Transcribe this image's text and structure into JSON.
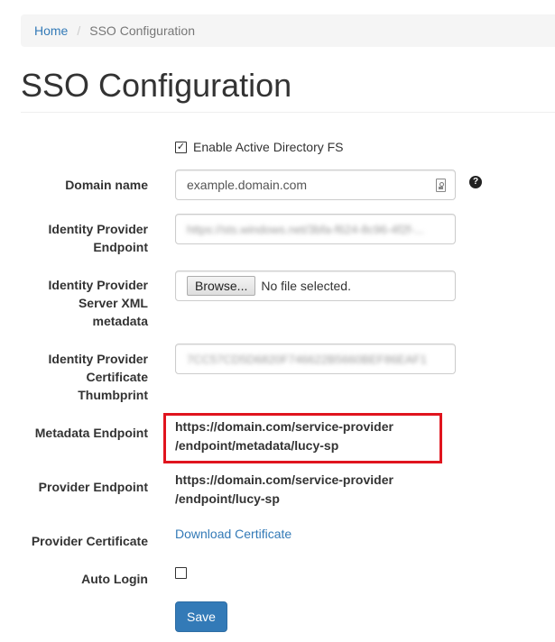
{
  "breadcrumb": {
    "home": "Home",
    "separator": "/",
    "current": "SSO Configuration"
  },
  "page": {
    "title": "SSO Configuration"
  },
  "form": {
    "enable_adfs": {
      "label": "Enable Active Directory FS",
      "checked": true
    },
    "domain_name": {
      "label": "Domain name",
      "value": "example.domain.com",
      "help_icon": "question-circle-icon"
    },
    "idp_endpoint": {
      "label_line1": "Identity Provider",
      "label_line2": "Endpoint",
      "value": "https://sts.windows.net/3bfa-f624-8c96-4f2f-..."
    },
    "idp_metadata": {
      "label_line1": "Identity Provider",
      "label_line2": "Server XML",
      "label_line3": "metadata",
      "browse_label": "Browse...",
      "file_status": "No file selected."
    },
    "idp_thumbprint": {
      "label_line1": "Identity Provider",
      "label_line2": "Certificate",
      "label_line3": "Thumbprint",
      "value": "7CC57CD5D6820F746622B5660BEF86EAF1"
    },
    "metadata_endpoint": {
      "label": "Metadata Endpoint",
      "value_line1": "https://domain.com/service-provider",
      "value_line2": "/endpoint/metadata/lucy-sp"
    },
    "provider_endpoint": {
      "label": "Provider Endpoint",
      "value_line1": "https://domain.com/service-provider",
      "value_line2": "/endpoint/lucy-sp"
    },
    "provider_certificate": {
      "label": "Provider Certificate",
      "link": "Download Certificate"
    },
    "auto_login": {
      "label": "Auto Login",
      "checked": false
    },
    "save_label": "Save"
  },
  "colors": {
    "link": "#337ab7",
    "primary_button": "#337ab7",
    "highlight_border": "#e0141e",
    "breadcrumb_bg": "#f5f5f5"
  }
}
